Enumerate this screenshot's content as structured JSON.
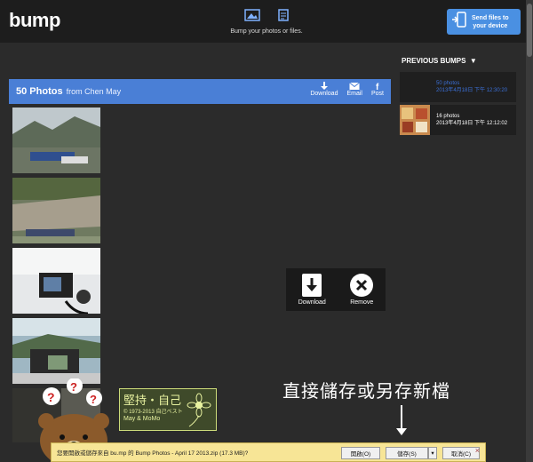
{
  "header": {
    "logo": "bump",
    "center_caption": "Bump your photos or files.",
    "send_button_label_line1": "Send files to",
    "send_button_label_line2": "your device"
  },
  "album": {
    "title": "50 Photos",
    "from": "from Chen May",
    "actions": [
      {
        "label": "Download",
        "icon": "download-icon"
      },
      {
        "label": "Email",
        "icon": "email-icon"
      },
      {
        "label": "Post",
        "icon": "facebook-icon"
      }
    ]
  },
  "photos": [
    {
      "name": "photo-mountain-town"
    },
    {
      "name": "photo-riverbed"
    },
    {
      "name": "photo-camera-window"
    },
    {
      "name": "photo-camera-landscape"
    },
    {
      "name": "photo-bear-sticker"
    }
  ],
  "previous_bumps": {
    "heading": "PREVIOUS BUMPS",
    "items": [
      {
        "count": "50 photos",
        "date": "2013年4月18日 下午 12:30:20",
        "color": "#3b6fd6"
      },
      {
        "count": "16 photos",
        "date": "2013年4月18日 下午 12:12:02",
        "color": "#ffffff"
      }
    ]
  },
  "overlay": {
    "download": "Download",
    "remove": "Remove"
  },
  "annotation": "直接儲存或另存新檔",
  "stamp": {
    "line1": "堅持・自己",
    "line2": "© 1973-2013 自己ベスト",
    "line3": "May & MoMo"
  },
  "download_bar": {
    "message": "您要開啟或儲存來自 bu.mp 的 Bump Photos - April 17 2013.zip (17.3 MB)?",
    "open": "開啟(O)",
    "save": "儲存(S)",
    "cancel": "取消(C)",
    "close": "×"
  },
  "colors": {
    "accent": "#4a7fd6",
    "send_button": "#4a90e2",
    "background": "#2b2b2b"
  }
}
